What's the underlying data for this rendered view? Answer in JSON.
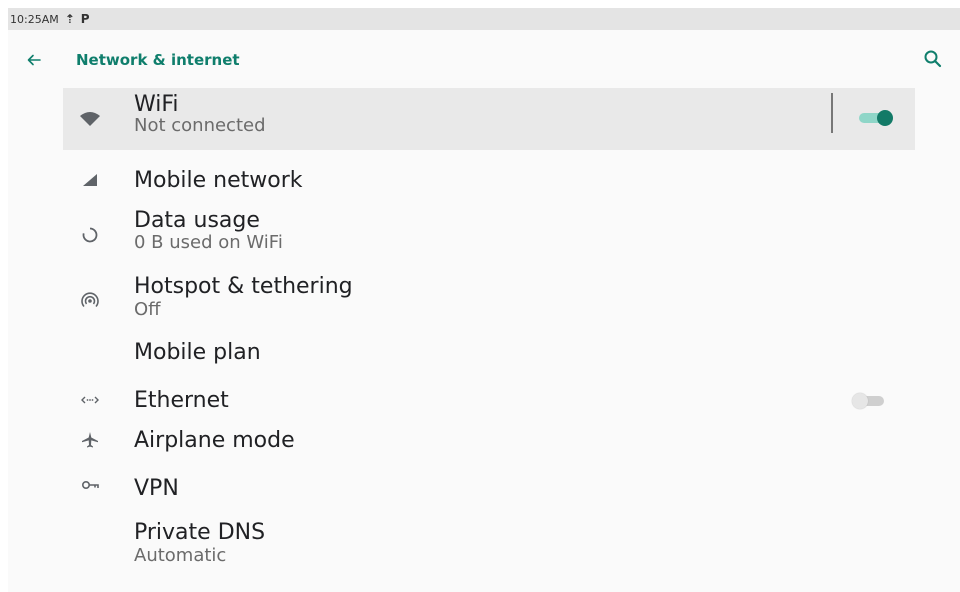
{
  "status_bar": {
    "time": "10:25AM",
    "icons": [
      "upload-icon",
      "parking-icon"
    ],
    "upload_glyph": "⇡",
    "parking_glyph": "P"
  },
  "toolbar": {
    "title": "Network & internet",
    "back_icon": "arrow-back-icon",
    "search_icon": "search-icon"
  },
  "accent_color": "#0f7e6c",
  "items": [
    {
      "label": "WiFi",
      "subtitle": "Not connected",
      "icon": "wifi-icon",
      "toggle": "on"
    },
    {
      "label": "Mobile network",
      "icon": "signal-icon"
    },
    {
      "label": "Data usage",
      "subtitle": "0 B used on WiFi",
      "icon": "data-usage-icon"
    },
    {
      "label": "Hotspot & tethering",
      "subtitle": "Off",
      "icon": "hotspot-icon"
    },
    {
      "label": "Mobile plan"
    },
    {
      "label": "Ethernet",
      "icon": "ethernet-icon",
      "toggle": "off"
    },
    {
      "label": "Airplane mode",
      "icon": "airplane-icon"
    },
    {
      "label": "VPN",
      "icon": "vpn-key-icon"
    },
    {
      "label": "Private DNS",
      "subtitle": "Automatic"
    }
  ]
}
